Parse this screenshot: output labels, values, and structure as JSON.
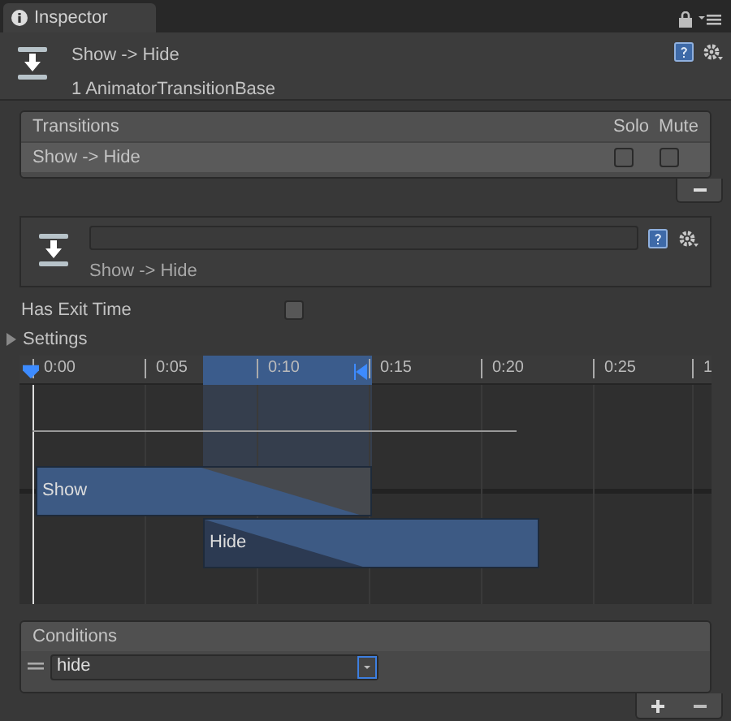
{
  "tab": {
    "label": "Inspector",
    "selected": true
  },
  "header": {
    "title": "Show -> Hide",
    "subtitle": "1 AnimatorTransitionBase"
  },
  "transitions": {
    "title": "Transitions",
    "columns": [
      "Solo",
      "Mute"
    ],
    "rows": [
      {
        "name": "Show -> Hide",
        "solo": false,
        "mute": false
      }
    ]
  },
  "object": {
    "caption": "Show -> Hide"
  },
  "has_exit_time": {
    "label": "Has Exit Time",
    "checked": false
  },
  "settings": {
    "label": "Settings",
    "expanded": false
  },
  "timeline": {
    "ticks": [
      "0:00",
      "0:05",
      "0:10",
      "0:15",
      "0:20",
      "0:25",
      "1"
    ],
    "clips": [
      {
        "name": "Show"
      },
      {
        "name": "Hide"
      }
    ]
  },
  "conditions": {
    "title": "Conditions",
    "items": [
      {
        "parameter": "hide"
      }
    ]
  }
}
